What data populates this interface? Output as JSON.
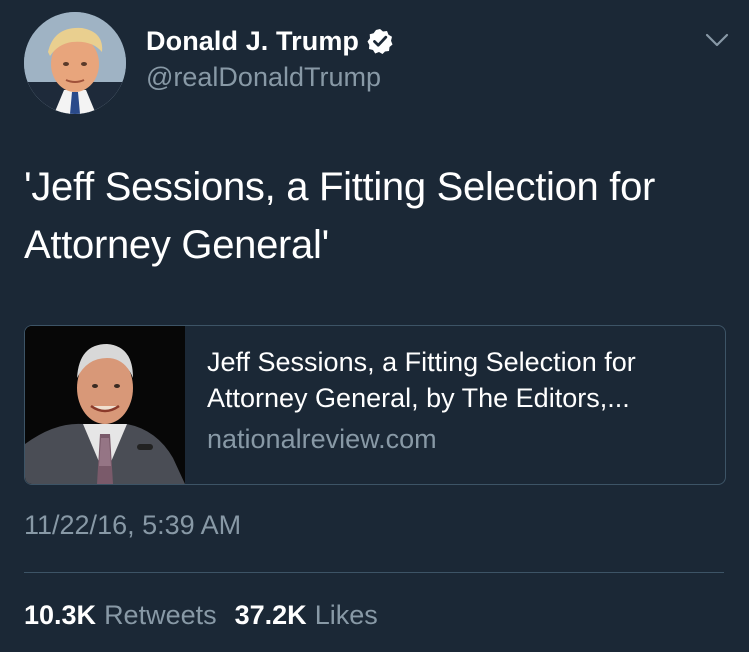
{
  "author": {
    "display_name": "Donald J. Trump",
    "handle": "@realDonaldTrump",
    "verified": true,
    "avatar_icon": "profile-photo"
  },
  "tweet": {
    "text": "'Jeff Sessions, a Fitting Selection for Attorney General'",
    "timestamp": "11/22/16, 5:39 AM"
  },
  "card": {
    "title": "Jeff Sessions, a Fitting Selection for\nAttorney General, by The Editors,...",
    "domain": "nationalreview.com",
    "thumbnail_icon": "article-thumbnail-photo"
  },
  "stats": {
    "retweets_count": "10.3K",
    "retweets_label": "Retweets",
    "likes_count": "37.2K",
    "likes_label": "Likes"
  },
  "colors": {
    "background": "#1b2836",
    "text_primary": "#ffffff",
    "text_secondary": "#8899a6",
    "border": "#3d5466",
    "verified_badge": "#ffffff"
  }
}
